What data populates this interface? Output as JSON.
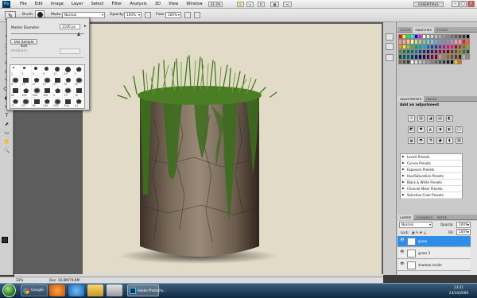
{
  "app": {
    "logo": "Ps",
    "workspace": "ESSENTIALS"
  },
  "menu": [
    "File",
    "Edit",
    "Image",
    "Layer",
    "Select",
    "Filter",
    "Analysis",
    "3D",
    "View",
    "Window",
    "Help"
  ],
  "menubar_extras": {
    "zoom": "33.3%"
  },
  "options": {
    "brush_label": "Brush:",
    "brush_size": "1100",
    "mode_label": "Mode:",
    "mode": "Normal",
    "opacity_label": "Opacity:",
    "opacity": "100%",
    "flow_label": "Flow:",
    "flow": "100%"
  },
  "brush_panel": {
    "master_label": "Master Diameter",
    "master_value": "1100 px",
    "use_sample": "Use Sample Size",
    "hardness_label": "Hardness:",
    "sizes": [
      "1",
      "3",
      "5",
      "9",
      "13",
      "19",
      "5",
      "9",
      "13",
      "17",
      "21",
      "27",
      "35",
      "45",
      "65",
      "100",
      "200",
      "300",
      "9",
      "13",
      "19",
      "17",
      "45",
      "65",
      "100",
      "200",
      "300",
      "14"
    ]
  },
  "tools": [
    "↖",
    "⬚",
    "⌖",
    "✂",
    "⊕",
    "✎",
    "⌫",
    "◐",
    "✒",
    "T",
    "⬈",
    "▭",
    "✋",
    "🔍"
  ],
  "status": {
    "zoom": "33%",
    "doc": "Doc: 10,8M/79,6M"
  },
  "swatch_tabs": [
    "COLOR",
    "SWATCHES",
    "STYLES"
  ],
  "swatch_colors": [
    "#ff0000",
    "#ffff00",
    "#00ff00",
    "#00ffff",
    "#0000ff",
    "#ff00ff",
    "#ffffff",
    "#ebebeb",
    "#d6d6d6",
    "#c2c2c2",
    "#adadad",
    "#999999",
    "#858585",
    "#707070",
    "#5c5c5c",
    "#474747",
    "#333333",
    "#000000",
    "#f7977a",
    "#f9ad81",
    "#fdc68a",
    "#fff79a",
    "#c4df9b",
    "#a2d39c",
    "#82ca9d",
    "#7bcdc8",
    "#6ecff6",
    "#7ea7d8",
    "#8493ca",
    "#8882be",
    "#a187be",
    "#bc8dbf",
    "#f49ac2",
    "#f6989d",
    "#ed1c24",
    "#f26522",
    "#f7941d",
    "#fff200",
    "#8dc63f",
    "#39b54a",
    "#00a651",
    "#00a99d",
    "#00aeef",
    "#0072bc",
    "#0054a6",
    "#2e3192",
    "#662d91",
    "#92278f",
    "#ec008c",
    "#ed145b",
    "#9e0b0f",
    "#a0410d",
    "#a36209",
    "#aba000",
    "#598527",
    "#1a7b30",
    "#007236",
    "#00746b",
    "#0076a3",
    "#004b80",
    "#003471",
    "#1b1464",
    "#440e62",
    "#630460",
    "#9e005d",
    "#9e0039",
    "#790000",
    "#7b2e00",
    "#7d4900",
    "#827b00",
    "#406618",
    "#005e20",
    "#005826",
    "#005952",
    "#005b7f",
    "#003663",
    "#002157",
    "#0d004c",
    "#32004b",
    "#4b0049",
    "#7b0046",
    "#7a0026",
    "#c69c6d",
    "#a67c52",
    "#8c6239",
    "#754c24",
    "#603913",
    "#3c2415",
    "#c7b299",
    "#998675",
    "#736357",
    "#534741",
    "#37302d",
    "#ffffff",
    "#e5e5e5",
    "#cccccc",
    "#b2b2b2",
    "#999999",
    "#7f7f7f",
    "#666666",
    "#4c4c4c",
    "#333333",
    "#191919",
    "#000000",
    "#ffcc00",
    "#ff6600"
  ],
  "adjust_tabs": [
    "ADJUSTMENTS",
    "MASKS"
  ],
  "adjust_title": "Add an adjustment",
  "presets": [
    "Levels Presets",
    "Curves Presets",
    "Exposure Presets",
    "Hue/Saturation Presets",
    "Black & White Presets",
    "Channel Mixer Presets",
    "Selective Color Presets"
  ],
  "layers_tabs": [
    "LAYERS",
    "CHANNELS",
    "PATHS"
  ],
  "layers": {
    "blend": "Normal",
    "opacity_label": "Opacity:",
    "opacity": "100%",
    "lock_label": "Lock:",
    "fill_label": "Fill:",
    "fill": "100%",
    "items": [
      {
        "name": "grass",
        "selected": true
      },
      {
        "name": "grass 1",
        "selected": false
      },
      {
        "name": "shadow inside",
        "selected": false
      }
    ]
  },
  "taskbar": {
    "items": [
      "Google",
      "Adobe Photosho..."
    ],
    "time": "13:21",
    "date": "23/10/2009"
  }
}
